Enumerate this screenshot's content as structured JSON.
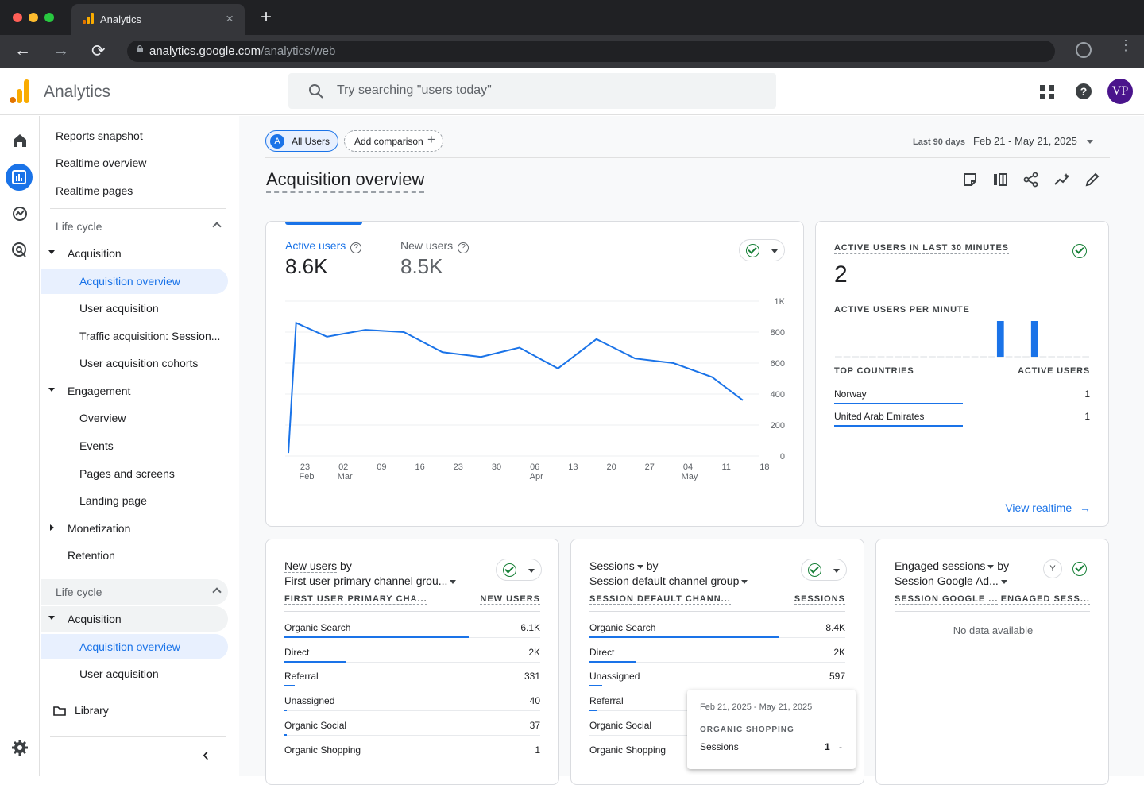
{
  "browser": {
    "tab_title": "Analytics",
    "close_glyph": "×",
    "newtab_glyph": "+",
    "back_glyph": "←",
    "forward_glyph": "→",
    "reload_glyph": "⟳",
    "url_host": "analytics.google.com",
    "url_path": "/analytics/web",
    "menu_glyph": "⋮"
  },
  "header": {
    "app_name": "Analytics",
    "search_placeholder": "Try searching \"users today\"",
    "avatar_initials": "VP"
  },
  "sidenav": {
    "top_items": [
      "Reports snapshot",
      "Realtime overview",
      "Realtime pages"
    ],
    "lifecycle_label": "Life cycle",
    "acquisition": {
      "label": "Acquisition",
      "items": [
        "Acquisition overview",
        "User acquisition",
        "Traffic acquisition: Session...",
        "User acquisition cohorts"
      ]
    },
    "engagement": {
      "label": "Engagement",
      "items": [
        "Overview",
        "Events",
        "Pages and screens",
        "Landing page"
      ]
    },
    "monetization_label": "Monetization",
    "retention_label": "Retention",
    "lifecycle2_label": "Life cycle",
    "acquisition2": {
      "label": "Acquisition",
      "items": [
        "Acquisition overview",
        "User acquisition"
      ]
    },
    "library_label": "Library",
    "collapse_glyph": "‹"
  },
  "toolbar": {
    "segment_letter": "A",
    "segment_label": "All Users",
    "add_comparison": "Add comparison",
    "add_glyph": "+",
    "date_preset": "Last 90 days",
    "date_range": "Feb 21 - May 21, 2025"
  },
  "page_title": "Acquisition overview",
  "chart_card": {
    "metric1_label": "Active users",
    "metric1_value": "8.6K",
    "metric2_label": "New users",
    "metric2_value": "8.5K",
    "help_glyph": "?"
  },
  "chart_data": {
    "type": "line",
    "x": [
      "Feb 21",
      "Feb 22",
      "Feb 27",
      "Mar 3",
      "Mar 8",
      "Mar 13",
      "Mar 18",
      "Mar 23",
      "Mar 28",
      "Apr 2",
      "Apr 7",
      "Apr 12",
      "Apr 17",
      "Apr 22",
      "Apr 27",
      "May 2",
      "May 7",
      "May 12",
      "May 17",
      "May 21"
    ],
    "series": [
      {
        "values": [
          20,
          860,
          770,
          815,
          800,
          670,
          640,
          700,
          565,
          755,
          630,
          600,
          510,
          360
        ]
      }
    ],
    "x_pos_days": [
      0,
      1,
      5,
      10,
      15,
      20,
      25,
      30,
      35,
      40,
      45,
      50,
      55,
      59
    ],
    "yticks": [
      "1K",
      "800",
      "600",
      "400",
      "200",
      "0"
    ],
    "ylim": [
      0,
      1000
    ],
    "xticks": [
      {
        "day": "23",
        "month": "Feb"
      },
      {
        "day": "02",
        "month": "Mar"
      },
      {
        "day": "09",
        "month": ""
      },
      {
        "day": "16",
        "month": ""
      },
      {
        "day": "23",
        "month": ""
      },
      {
        "day": "30",
        "month": ""
      },
      {
        "day": "06",
        "month": "Apr"
      },
      {
        "day": "13",
        "month": ""
      },
      {
        "day": "20",
        "month": ""
      },
      {
        "day": "27",
        "month": ""
      },
      {
        "day": "04",
        "month": "May"
      },
      {
        "day": "11",
        "month": ""
      },
      {
        "day": "18",
        "month": ""
      }
    ],
    "grid": true,
    "color": "#1a73e8"
  },
  "realtime": {
    "title": "ACTIVE USERS IN LAST 30 MINUTES",
    "value": "2",
    "per_minute_label": "ACTIVE USERS PER MINUTE",
    "per_minute_bars": [
      0,
      0,
      0,
      0,
      0,
      0,
      0,
      0,
      0,
      0,
      0,
      0,
      0,
      0,
      0,
      0,
      0,
      0,
      0,
      1,
      0,
      0,
      0,
      1,
      0,
      0,
      0,
      0,
      0,
      0
    ],
    "col1": "TOP COUNTRIES",
    "col2": "ACTIVE USERS",
    "rows": [
      {
        "name": "Norway",
        "value": "1"
      },
      {
        "name": "United Arab Emirates",
        "value": "1"
      }
    ],
    "view_link": "View realtime",
    "arrow_glyph": "→"
  },
  "table1": {
    "title_line1_a": "New users",
    "title_line1_b": " by",
    "title_line2": "First user primary channel grou...",
    "col1": "FIRST USER PRIMARY CHA...",
    "col2": "NEW USERS",
    "rows": [
      {
        "name": "Organic Search",
        "value": "6.1K",
        "pct": 0.72
      },
      {
        "name": "Direct",
        "value": "2K",
        "pct": 0.24
      },
      {
        "name": "Referral",
        "value": "331",
        "pct": 0.04
      },
      {
        "name": "Unassigned",
        "value": "40",
        "pct": 0.01
      },
      {
        "name": "Organic Social",
        "value": "37",
        "pct": 0.01
      },
      {
        "name": "Organic Shopping",
        "value": "1",
        "pct": 0.0
      }
    ]
  },
  "table2": {
    "title_line1_a": "Sessions",
    "title_line1_b": " by",
    "title_line2": "Session default channel group",
    "col1": "SESSION DEFAULT CHANN...",
    "col2": "SESSIONS",
    "rows": [
      {
        "name": "Organic Search",
        "value": "8.4K",
        "pct": 0.74
      },
      {
        "name": "Direct",
        "value": "2K",
        "pct": 0.18
      },
      {
        "name": "Unassigned",
        "value": "597",
        "pct": 0.05
      },
      {
        "name": "Referral",
        "value": "",
        "pct": 0.03
      },
      {
        "name": "Organic Social",
        "value": "",
        "pct": 0.0
      },
      {
        "name": "Organic Shopping",
        "value": "",
        "pct": 0.0
      }
    ]
  },
  "table3": {
    "title_line1_a": "Engaged sessions",
    "title_line1_b": " by",
    "title_line2": "Session Google Ad...",
    "col1": "SESSION GOOGLE ...",
    "col2": "ENGAGED SESS...",
    "filter_glyph": "Y",
    "no_data": "No data available"
  },
  "tooltip": {
    "date": "Feb 21, 2025 - May 21, 2025",
    "category": "ORGANIC SHOPPING",
    "metric": "Sessions",
    "value": "1",
    "dash": "-"
  }
}
